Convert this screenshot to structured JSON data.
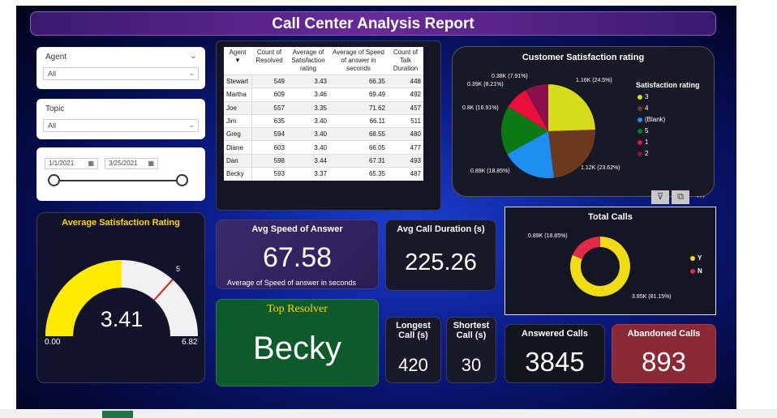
{
  "report_title": "Call Center Analysis Report",
  "filters": {
    "agent": {
      "label": "Agent",
      "value": "All"
    },
    "topic": {
      "label": "Topic",
      "value": "All"
    },
    "date_start": "1/1/2021",
    "date_end": "3/25/2021"
  },
  "agent_table": {
    "columns": [
      "Agent",
      "Count of Resolved",
      "Average of Satisfaction rating",
      "Average of Speed of answer in seconds",
      "Count of Talk Duration"
    ],
    "rows": [
      [
        "Stewart",
        "549",
        "3.43",
        "66.35",
        "448"
      ],
      [
        "Martha",
        "609",
        "3.46",
        "69.49",
        "492"
      ],
      [
        "Joe",
        "557",
        "3.35",
        "71.62",
        "457"
      ],
      [
        "Jim",
        "635",
        "3.40",
        "66.11",
        "511"
      ],
      [
        "Greg",
        "594",
        "3.40",
        "68.55",
        "480"
      ],
      [
        "Diane",
        "603",
        "3.40",
        "66.05",
        "477"
      ],
      [
        "Dan",
        "598",
        "3.44",
        "67.31",
        "493"
      ],
      [
        "Becky",
        "593",
        "3.37",
        "65.35",
        "487"
      ]
    ]
  },
  "satisfaction_chart": {
    "title": "Customer Satisfaction rating",
    "legend_title": "Satisfaction rating",
    "slices": [
      {
        "name": "3",
        "value": 1160,
        "label": "1.16K (24.5%)",
        "color": "#d4dc1a"
      },
      {
        "name": "4",
        "value": 1120,
        "label": "1.12K (23.62%)",
        "color": "#6b3a1e"
      },
      {
        "name": "(Blank)",
        "value": 890,
        "label": "0.89K (18.85%)",
        "color": "#1e8ef0"
      },
      {
        "name": "5",
        "value": 800,
        "label": "0.8K (16.91%)",
        "color": "#0a7a12"
      },
      {
        "name": "1",
        "value": 390,
        "label": "0.39K (8.21%)",
        "color": "#e8103a"
      },
      {
        "name": "2",
        "value": 380,
        "label": "0.38K (7.91%)",
        "color": "#8a0f4a"
      }
    ]
  },
  "gauge": {
    "title": "Average Satisfaction Rating",
    "value": 3.41,
    "value_text": "3.41",
    "min_text": "0.00",
    "max": 6.82,
    "max_text": "6.82",
    "target": 5,
    "target_text": "5",
    "fill_color": "#ffea00",
    "bg_color": "#f2f2f2",
    "target_color": "#e01b1b"
  },
  "avg_speed": {
    "title": "Avg Speed of Answer",
    "value": "67.58",
    "subtitle": "Average of Speed of answer in seconds"
  },
  "avg_duration": {
    "title": "Avg Call Duration (s)",
    "value": "225.26"
  },
  "top_resolver": {
    "title": "Top Resolver",
    "value": "Becky"
  },
  "longest_call": {
    "title": "Longest Call (s)",
    "value": "420"
  },
  "shortest_call": {
    "title": "Shortest Call (s)",
    "value": "30"
  },
  "answered_calls": {
    "title": "Answered Calls",
    "value": "3845"
  },
  "abandoned_calls": {
    "title": "Abandoned Calls",
    "value": "893"
  },
  "total_calls_chart": {
    "title": "Total Calls",
    "slices": [
      {
        "name": "Y",
        "value": 3850,
        "label": "3.85K (81.15%)",
        "color": "#f0dc14"
      },
      {
        "name": "N",
        "value": 890,
        "label": "0.89K (18.85%)",
        "color": "#e02a48"
      }
    ]
  },
  "icons": [
    "filter-icon",
    "focus-mode-icon",
    "more-options-icon"
  ]
}
